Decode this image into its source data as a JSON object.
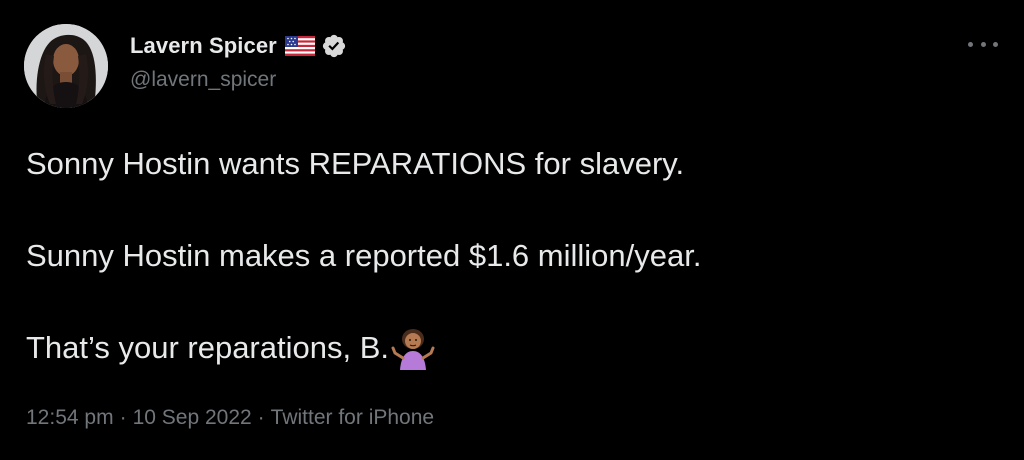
{
  "author": {
    "display_name": "Lavern Spicer",
    "handle": "@lavern_spicer",
    "flag_icon": "us-flag-icon",
    "verified_icon": "verified-badge-icon"
  },
  "tweet": {
    "lines": [
      "Sonny Hostin wants REPARATIONS for slavery.",
      "Sunny Hostin makes a reported $1.6 million/year.",
      "That’s your reparations, B."
    ],
    "trailing_emoji": "person-shrugging-icon"
  },
  "meta": {
    "time": "12:54 pm",
    "separator": "·",
    "date": "10 Sep 2022",
    "source": "Twitter for iPhone"
  },
  "more_icon": "more-options-icon",
  "colors": {
    "background": "#000000",
    "text": "#e7e9ea",
    "secondary": "#71767b"
  }
}
